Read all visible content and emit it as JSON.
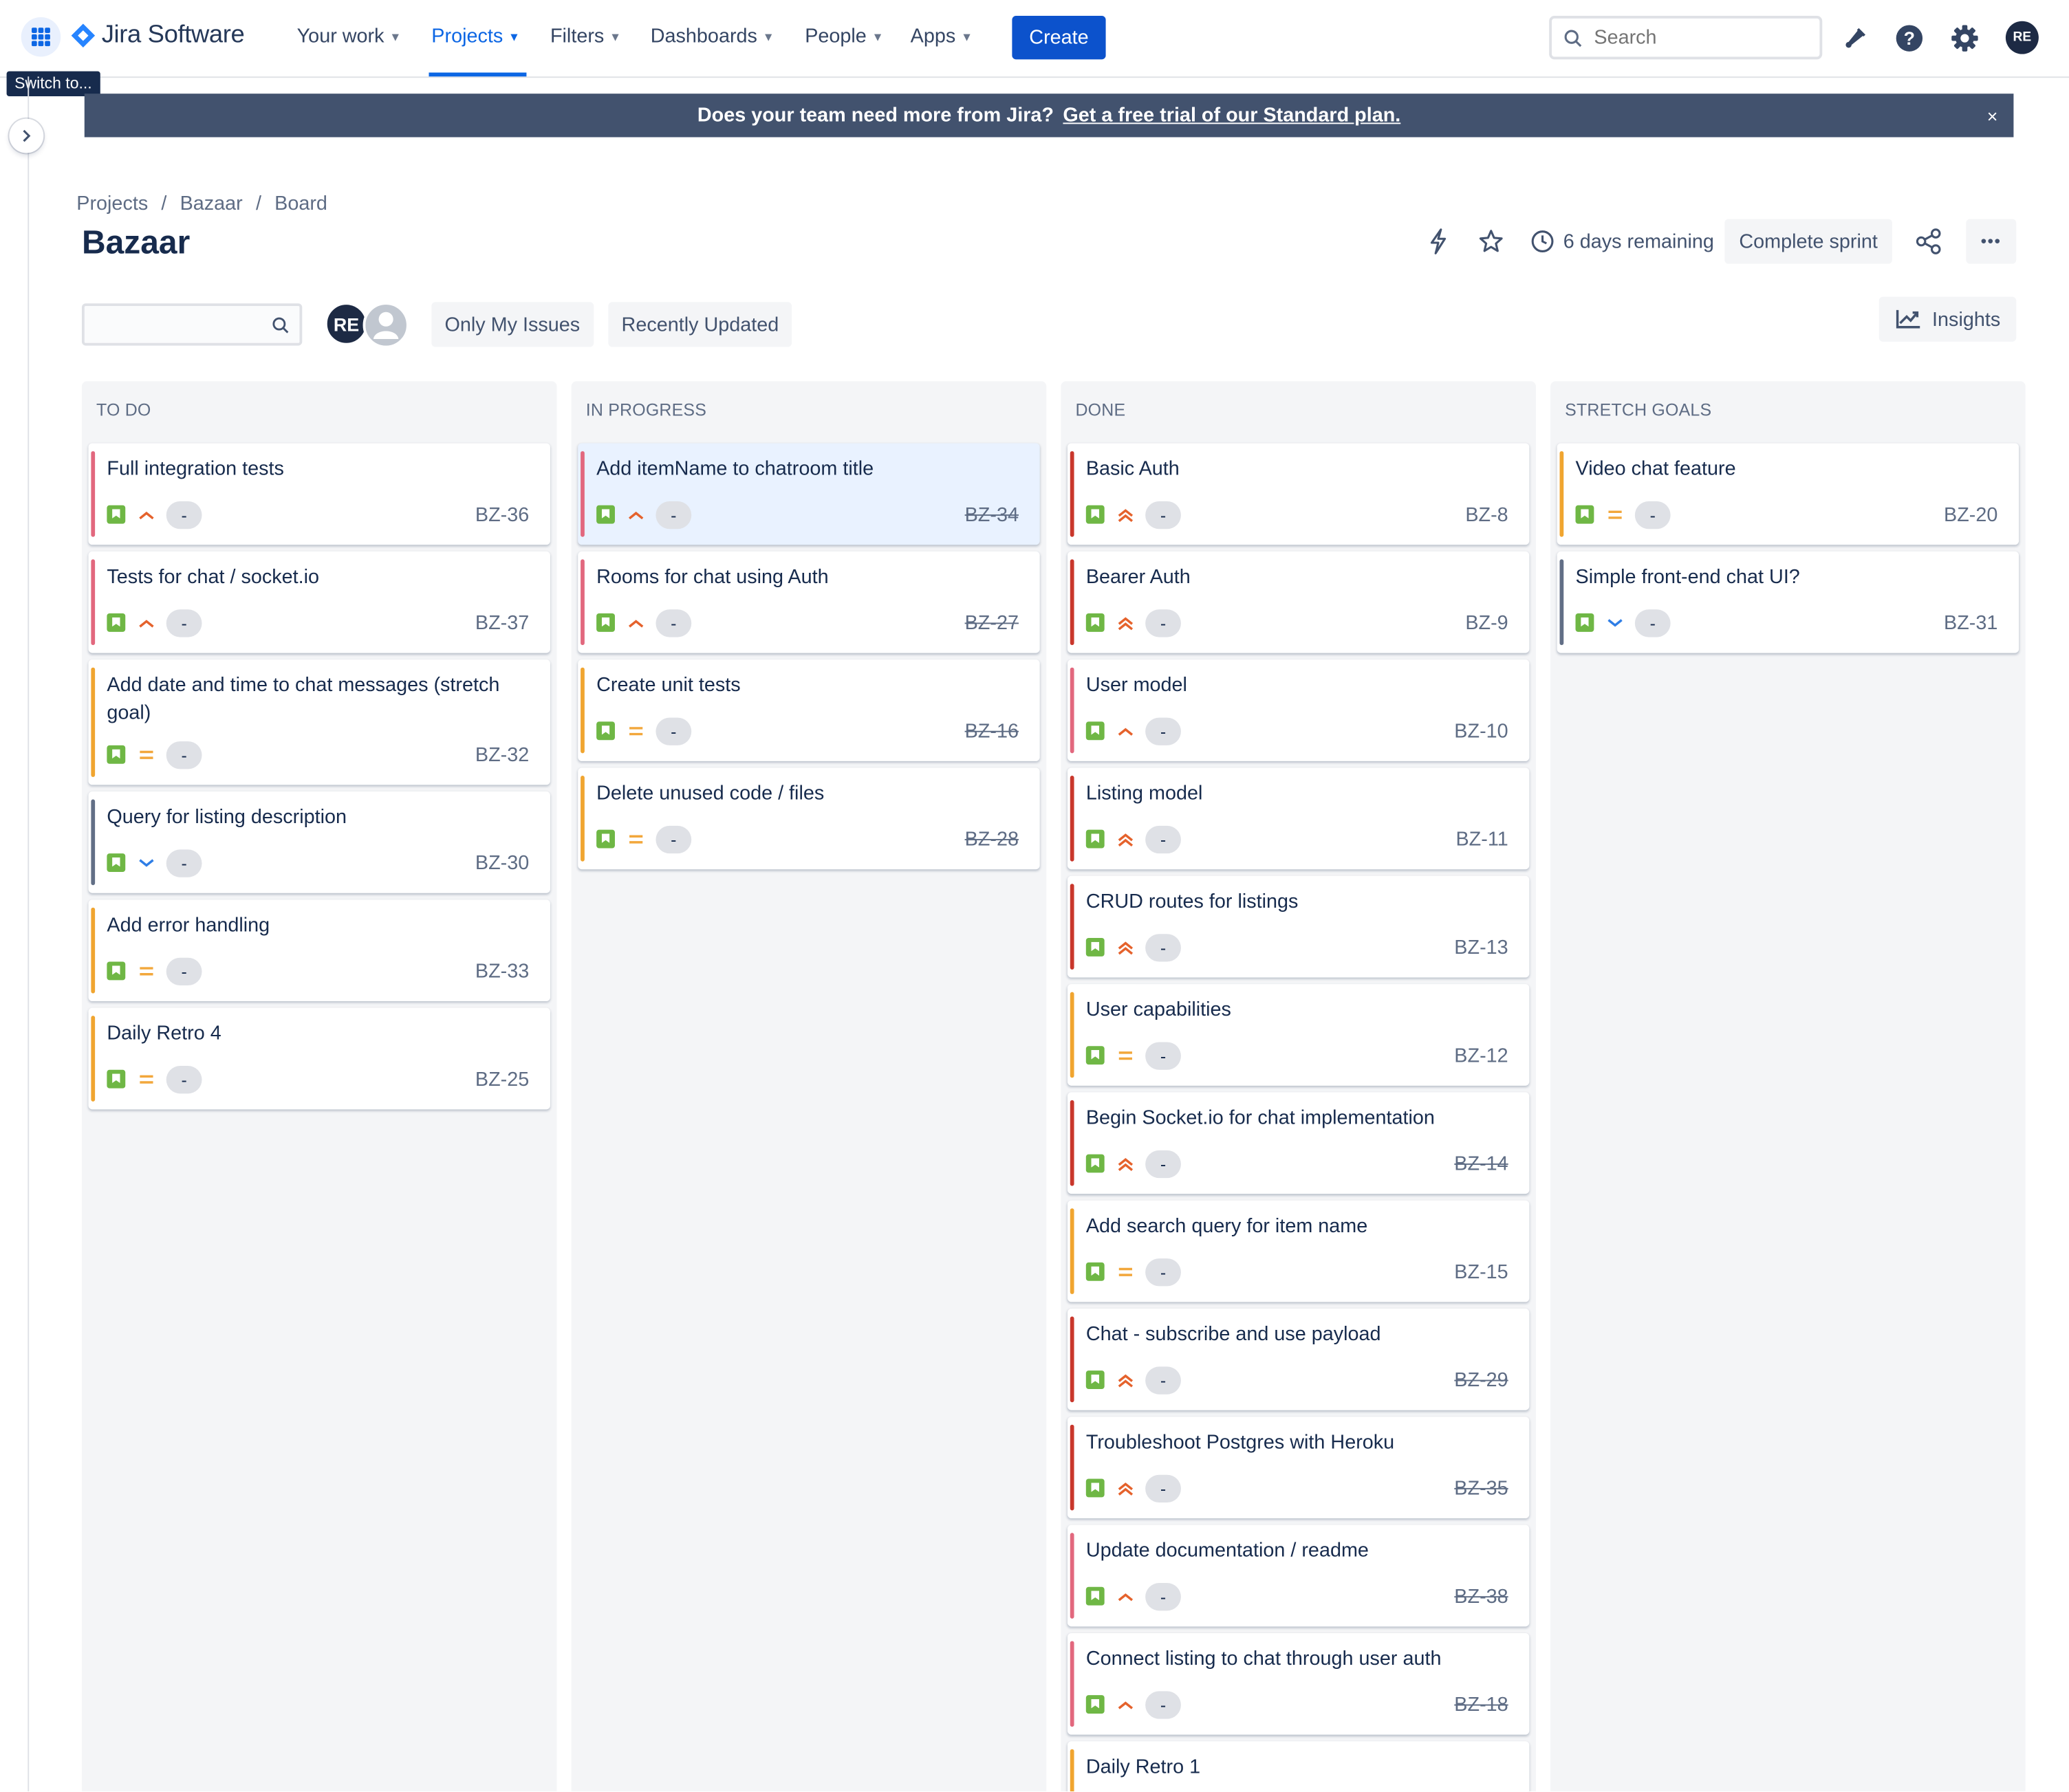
{
  "nav": {
    "app_name": "Jira Software",
    "items": [
      {
        "label": "Your work",
        "active": false
      },
      {
        "label": "Projects",
        "active": true
      },
      {
        "label": "Filters",
        "active": false
      },
      {
        "label": "Dashboards",
        "active": false
      },
      {
        "label": "People",
        "active": false
      },
      {
        "label": "Apps",
        "active": false
      }
    ],
    "create_label": "Create",
    "search_placeholder": "Search",
    "user_initials": "RE"
  },
  "tooltip": "Switch to...",
  "banner": {
    "text": "Does your team need more from Jira?",
    "link": "Get a free trial of our Standard plan.",
    "close": "×"
  },
  "breadcrumb": [
    "Projects",
    "Bazaar",
    "Board"
  ],
  "breadcrumb_sep": "/",
  "page_title": "Bazaar",
  "sprint": {
    "days_remaining": "6 days remaining",
    "complete_label": "Complete sprint",
    "more_label": "•••"
  },
  "filters": {
    "avatar_initials": "RE",
    "only_my_issues": "Only My Issues",
    "recently_updated": "Recently Updated",
    "insights": "Insights"
  },
  "colors": {
    "accent": "#0c66e4",
    "story_green": "#6fb745",
    "epic_pink": "#e2687e",
    "epic_orange": "#f0a530",
    "epic_red": "#c9372c",
    "epic_grey": "#626f86",
    "prio_high": "#e5622c",
    "prio_medium": "#f2a73b",
    "prio_low": "#2f7ee6"
  },
  "columns": [
    {
      "title": "TO DO",
      "cards": [
        {
          "title": "Full integration tests",
          "key": "BZ-36",
          "priority": "high",
          "epic": "pink",
          "points": "-",
          "done": false
        },
        {
          "title": "Tests for chat / socket.io",
          "key": "BZ-37",
          "priority": "high",
          "epic": "pink",
          "points": "-",
          "done": false
        },
        {
          "title": "Add date and time to chat messages (stretch goal)",
          "key": "BZ-32",
          "priority": "medium",
          "epic": "orange",
          "points": "-",
          "done": false
        },
        {
          "title": "Query for listing description",
          "key": "BZ-30",
          "priority": "low",
          "epic": "grey",
          "points": "-",
          "done": false
        },
        {
          "title": "Add error handling",
          "key": "BZ-33",
          "priority": "medium",
          "epic": "orange",
          "points": "-",
          "done": false
        },
        {
          "title": "Daily Retro 4",
          "key": "BZ-25",
          "priority": "medium",
          "epic": "orange",
          "points": "-",
          "done": false
        }
      ]
    },
    {
      "title": "IN PROGRESS",
      "cards": [
        {
          "title": "Add itemName to chatroom title",
          "key": "BZ-34",
          "priority": "high",
          "epic": "pink",
          "points": "-",
          "done": true,
          "selected": true
        },
        {
          "title": "Rooms for chat using Auth",
          "key": "BZ-27",
          "priority": "high",
          "epic": "pink",
          "points": "-",
          "done": true
        },
        {
          "title": "Create unit tests",
          "key": "BZ-16",
          "priority": "medium",
          "epic": "orange",
          "points": "-",
          "done": true
        },
        {
          "title": "Delete unused code / files",
          "key": "BZ-28",
          "priority": "medium",
          "epic": "orange",
          "points": "-",
          "done": true
        }
      ]
    },
    {
      "title": "DONE",
      "cards": [
        {
          "title": "Basic Auth",
          "key": "BZ-8",
          "priority": "highest",
          "epic": "red",
          "points": "-",
          "done": false
        },
        {
          "title": "Bearer Auth",
          "key": "BZ-9",
          "priority": "highest",
          "epic": "red",
          "points": "-",
          "done": false
        },
        {
          "title": "User model",
          "key": "BZ-10",
          "priority": "high",
          "epic": "pink",
          "points": "-",
          "done": false
        },
        {
          "title": "Listing model",
          "key": "BZ-11",
          "priority": "highest",
          "epic": "red",
          "points": "-",
          "done": false
        },
        {
          "title": "CRUD routes for listings",
          "key": "BZ-13",
          "priority": "highest",
          "epic": "red",
          "points": "-",
          "done": false
        },
        {
          "title": "User capabilities",
          "key": "BZ-12",
          "priority": "medium",
          "epic": "orange",
          "points": "-",
          "done": false
        },
        {
          "title": "Begin Socket.io for chat implementation",
          "key": "BZ-14",
          "priority": "highest",
          "epic": "red",
          "points": "-",
          "done": true
        },
        {
          "title": "Add search query for item name",
          "key": "BZ-15",
          "priority": "medium",
          "epic": "orange",
          "points": "-",
          "done": false
        },
        {
          "title": "Chat - subscribe and use payload",
          "key": "BZ-29",
          "priority": "highest",
          "epic": "red",
          "points": "-",
          "done": true
        },
        {
          "title": "Troubleshoot Postgres with Heroku",
          "key": "BZ-35",
          "priority": "highest",
          "epic": "red",
          "points": "-",
          "done": true
        },
        {
          "title": "Update documentation / readme",
          "key": "BZ-38",
          "priority": "high",
          "epic": "pink",
          "points": "-",
          "done": true
        },
        {
          "title": "Connect listing to chat through user auth",
          "key": "BZ-18",
          "priority": "high",
          "epic": "pink",
          "points": "-",
          "done": true
        },
        {
          "title": "Daily Retro 1",
          "key": "",
          "priority": "medium",
          "epic": "orange",
          "points": "-",
          "done": false
        }
      ]
    },
    {
      "title": "STRETCH GOALS",
      "cards": [
        {
          "title": "Video chat feature",
          "key": "BZ-20",
          "priority": "medium",
          "epic": "orange",
          "points": "-",
          "done": false
        },
        {
          "title": "Simple front-end chat UI?",
          "key": "BZ-31",
          "priority": "low",
          "epic": "grey",
          "points": "-",
          "done": false
        }
      ]
    }
  ]
}
